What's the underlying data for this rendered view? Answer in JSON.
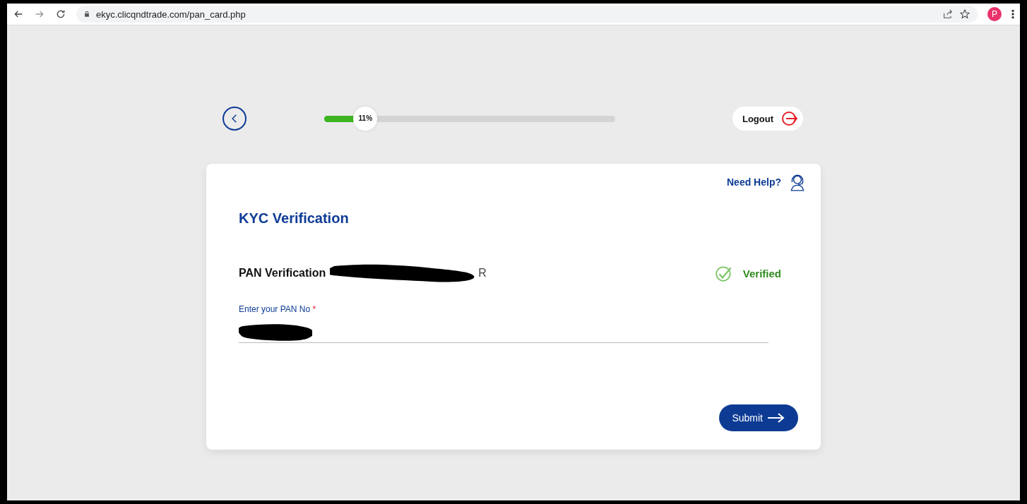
{
  "browser": {
    "url": "ekyc.clicqndtrade.com/pan_card.php",
    "profile_initial": "P"
  },
  "progress": {
    "level": 0.11,
    "reading": "11%"
  },
  "logout": {
    "label": "Logout"
  },
  "card": {
    "help": "Need Help?",
    "title": "KYC Verification",
    "pan": {
      "label": "PAN Verification",
      "name_visible_tail": "R",
      "status": "Verified",
      "verified": true
    },
    "field": {
      "label": "Enter your PAN No",
      "required_mark": "*"
    },
    "submit": {
      "label": "Submit"
    }
  }
}
